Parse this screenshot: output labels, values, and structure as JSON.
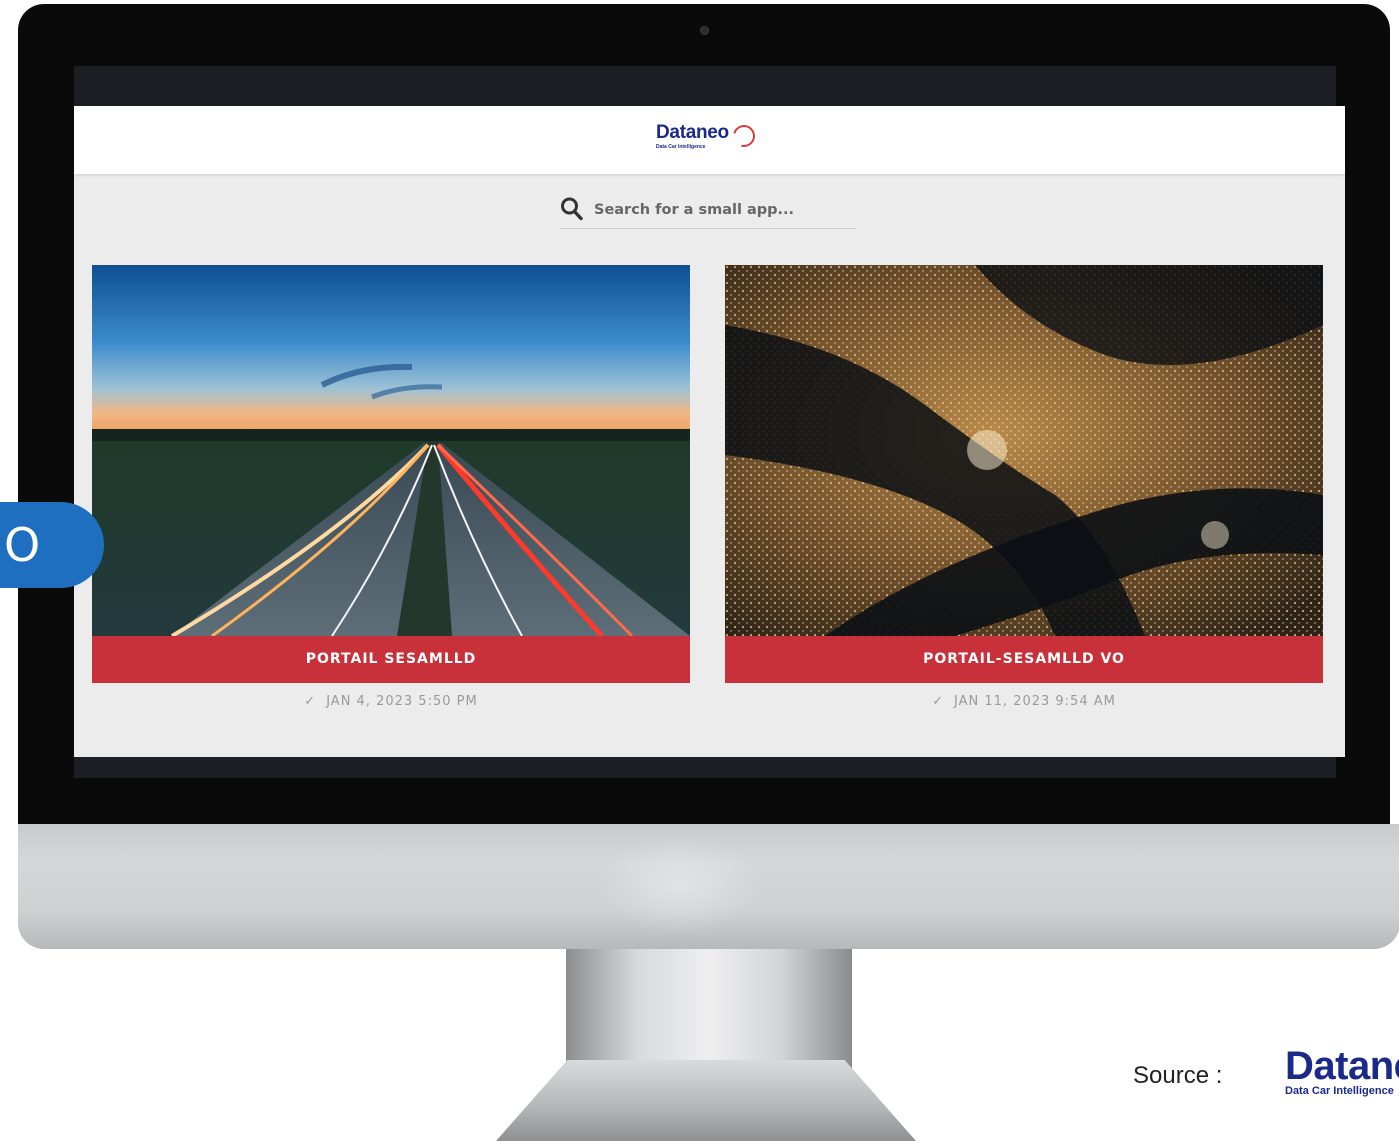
{
  "header": {
    "logo_text": "Dataneo",
    "logo_tagline": "Data Car Intelligence"
  },
  "search": {
    "placeholder": "Search for a small app...",
    "icon": "search-icon"
  },
  "apps": [
    {
      "title": "PORTAIL SESAMLLD",
      "date": "JAN 4, 2023 5:50 PM",
      "image": "highway-at-dusk-with-light-trails"
    },
    {
      "title": "PORTAIL-SESAMLLD VO",
      "date": "JAN 11, 2023 9:54 AM",
      "image": "city-at-night-from-space"
    }
  ],
  "side_tab": {
    "glyph": "O"
  },
  "source": {
    "label": "Source :",
    "logo_text": "Dataneo",
    "logo_tagline": "Data Car Intelligence"
  },
  "colors": {
    "brand_blue": "#1b2a8a",
    "card_bar_red": "#c8313a",
    "side_tab_blue": "#1f6fc1",
    "app_background": "#ececec"
  }
}
